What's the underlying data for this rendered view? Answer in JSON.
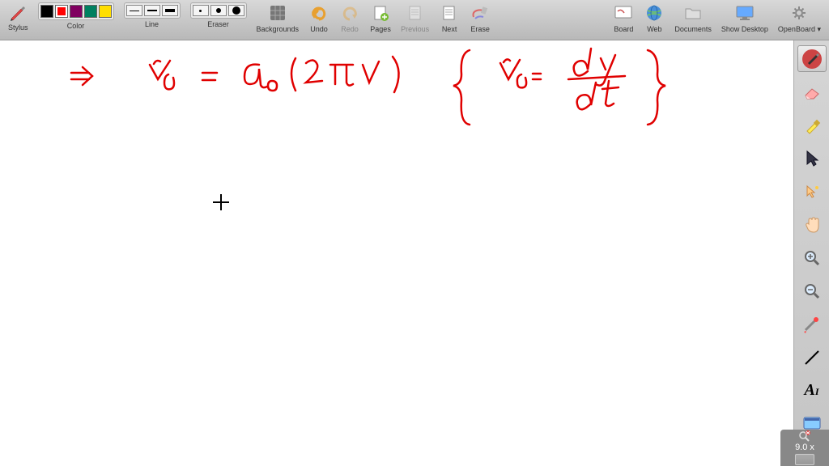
{
  "toolbar": {
    "stylus_label": "Stylus",
    "color_label": "Color",
    "line_label": "Line",
    "eraser_label": "Eraser",
    "backgrounds_label": "Backgrounds",
    "undo_label": "Undo",
    "redo_label": "Redo",
    "pages_label": "Pages",
    "previous_label": "Previous",
    "next_label": "Next",
    "erase_label": "Erase",
    "board_label": "Board",
    "web_label": "Web",
    "documents_label": "Documents",
    "show_desktop_label": "Show Desktop",
    "openboard_label": "OpenBoard",
    "colors": [
      "#000000",
      "#ff0000",
      "#800060",
      "#008060",
      "#ffde00"
    ]
  },
  "zoom": {
    "level": "9.0 x"
  },
  "handwriting": {
    "arrow": "⇒",
    "eq1_left": "v",
    "eq1_left_sub": "p",
    "eq1_equals": "=",
    "eq1_a": "a",
    "eq1_a_sub": "o",
    "eq1_paren": "( 2πν )",
    "brace_v": "v",
    "brace_v_sub": "p",
    "brace_eq": "=",
    "brace_dy": "dy",
    "brace_frac": "―",
    "brace_dt": "dt"
  }
}
